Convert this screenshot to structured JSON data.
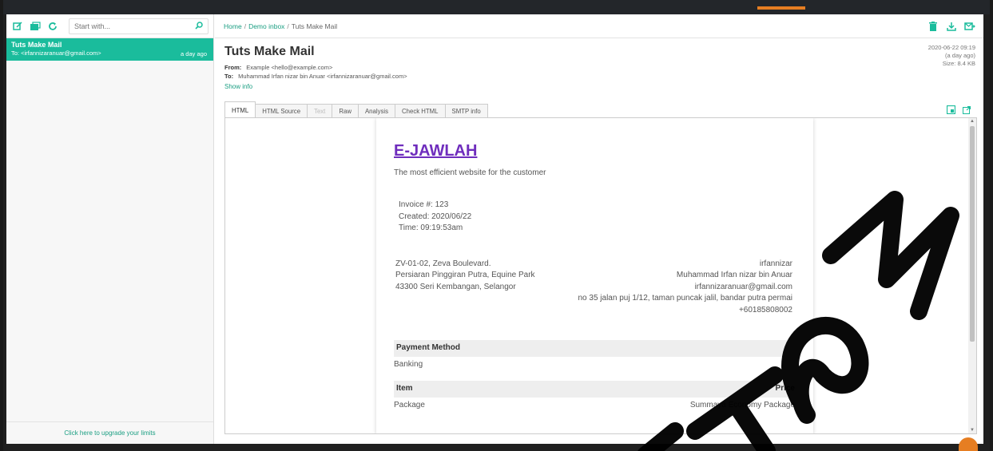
{
  "toolbar": {
    "search_placeholder": "Start with..."
  },
  "message": {
    "subject": "Tuts Make Mail",
    "to_line": "To: <irfannizaranuar@gmail.com>",
    "when": "a day ago"
  },
  "sidebar": {
    "upgrade_text": "Click here to upgrade your limits"
  },
  "breadcrumb": {
    "home": "Home",
    "inbox": "Demo inbox",
    "current": "Tuts Make Mail",
    "sep": "/"
  },
  "email": {
    "title": "Tuts Make Mail",
    "from_label": "From:",
    "from_value": "Example <hello@example.com>",
    "to_label": "To:",
    "to_value": "Muhammad Irfan nizar bin Anuar <irfannizaranuar@gmail.com>",
    "show_info": "Show info",
    "date": "2020-06-22 09:19",
    "relative": "(a day ago)",
    "size": "Size: 8.4 KB"
  },
  "tabs": [
    "HTML",
    "HTML Source",
    "Text",
    "Raw",
    "Analysis",
    "Check HTML",
    "SMTP info"
  ],
  "invoice": {
    "brand": "E-JAWLAH",
    "tagline": "The most efficient website for the customer",
    "number": "Invoice #: 123",
    "created": "Created: 2020/06/22",
    "time": "Time: 09:19:53am",
    "from_addr": [
      "ZV-01-02, Zeva Boulevard.",
      "Persiaran Pinggiran Putra, Equine Park",
      "43300 Seri Kembangan, Selangor"
    ],
    "to_addr": [
      "irfannizar",
      "Muhammad Irfan nizar bin Anuar",
      "irfannizaranuar@gmail.com",
      "no 35 jalan puj 1/12, taman puncak jalil, bandar putra permai",
      "+60185808002"
    ],
    "payment_head": "Payment Method",
    "payment_value": "Banking",
    "item_head": "Item",
    "price_head": "Price",
    "item_name": "Package",
    "item_price": "Summaya Economy Package"
  },
  "watermark": "ITSM",
  "colors": {
    "accent": "#1abc9c",
    "link": "#1a9e82",
    "brand": "#6f2dbd"
  }
}
